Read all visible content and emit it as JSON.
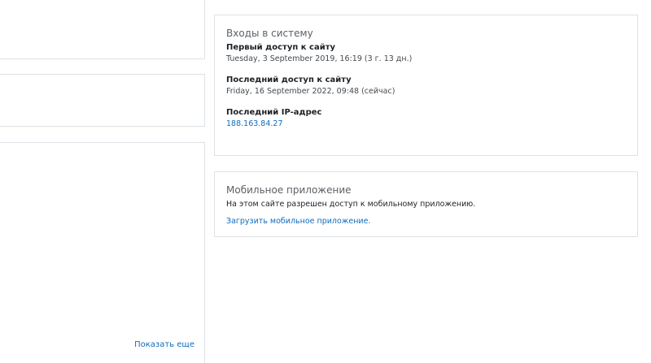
{
  "left": {
    "show_more_label": "Показать еще"
  },
  "logins": {
    "title": "Входы в систему",
    "first_access": {
      "label": "Первый доступ к сайту",
      "value": "Tuesday, 3 September 2019, 16:19  (3 г. 13 дн.)"
    },
    "last_access": {
      "label": "Последний доступ к сайту",
      "value": "Friday, 16 September 2022, 09:48  (сейчас)"
    },
    "last_ip": {
      "label": "Последний IP-адрес",
      "value": "188.163.84.27"
    }
  },
  "mobile": {
    "title": "Мобильное приложение",
    "text": "На этом сайте разрешен доступ к мобильному приложению.",
    "link_label": "Загрузить мобильное приложение."
  },
  "colors": {
    "link": "#0f6cbf",
    "border": "#dee2e6",
    "muted": "#5b6166"
  }
}
